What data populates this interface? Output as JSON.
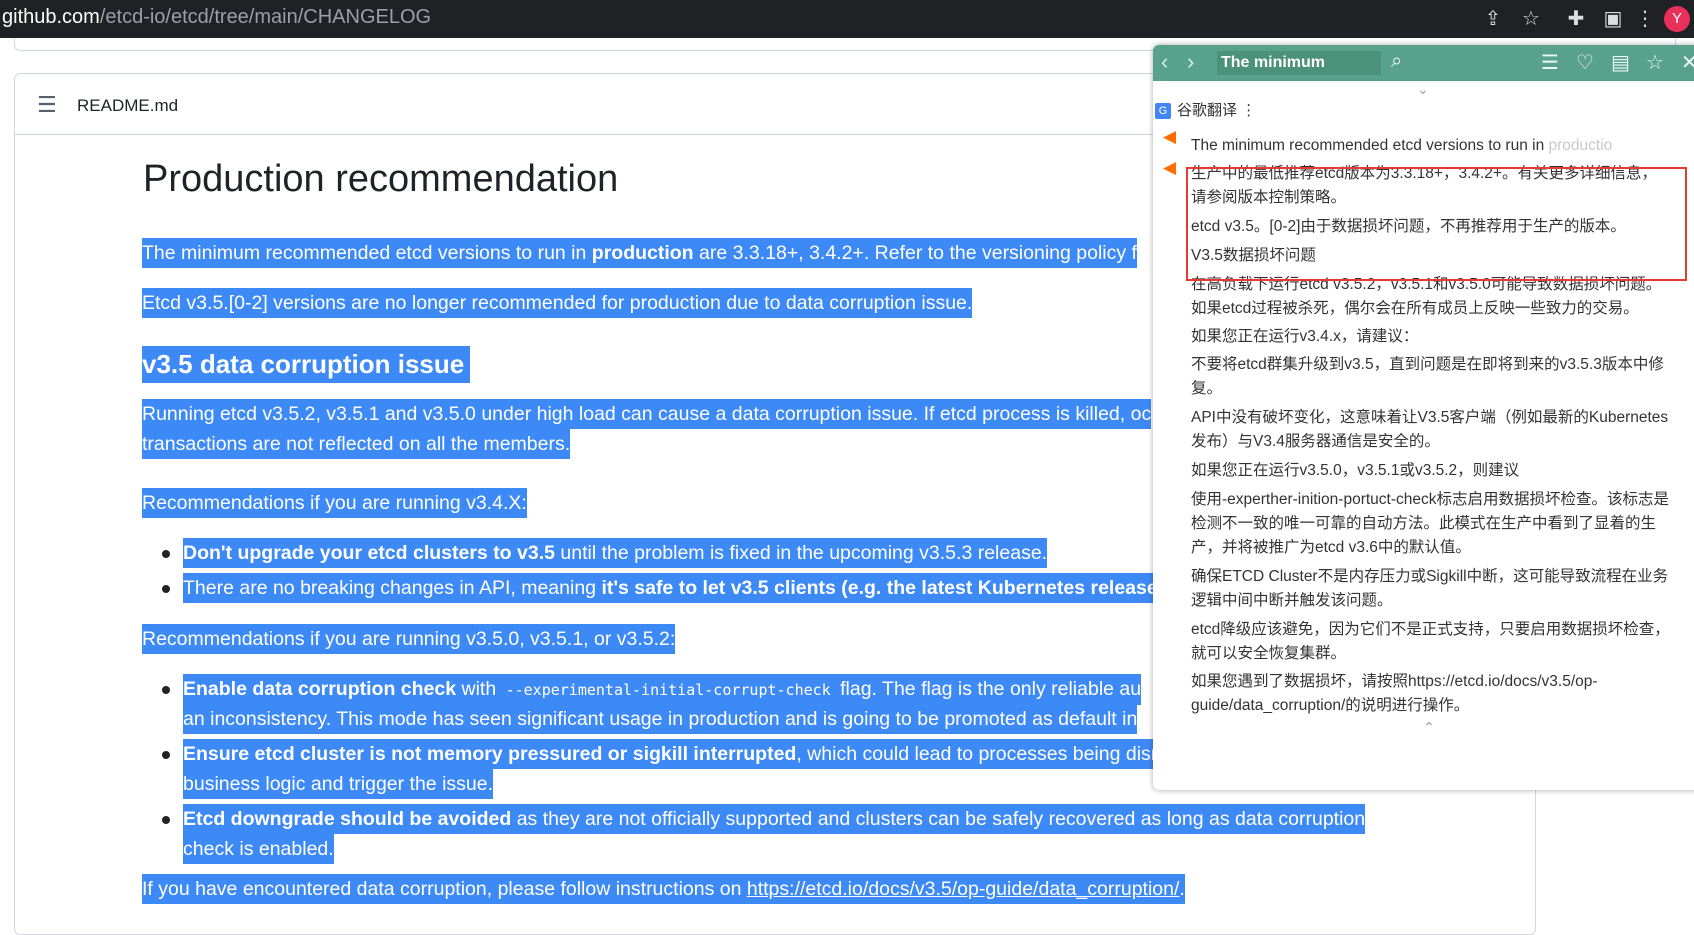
{
  "browser": {
    "url_host": "github.com",
    "url_path": "/etcd-io/etcd/tree/main/CHANGELOG",
    "avatar_letter": "Y"
  },
  "readme": {
    "file_name": "README.md",
    "heading": "Production recommendation",
    "p1_a": "The minimum recommended etcd versions to run in ",
    "p1_b": "production",
    "p1_c": " are 3.3.18+, 3.4.2+. Refer to the versioning policy f",
    "p2": "Etcd v3.5.[0-2] versions are no longer recommended for production due to data corruption issue.",
    "h2": "v3.5 data corruption issue",
    "p3_line1": "Running etcd v3.5.2, v3.5.1 and v3.5.0 under high load can cause a data corruption issue. If etcd process is killed, oc",
    "p3_line2": "transactions are not reflected on all the members.",
    "rec1": "Recommendations if you are running v3.4.X:",
    "b1_bold": "Don't upgrade your etcd clusters to v3.5",
    "b1_rest": " until the problem is fixed in the upcoming v3.5.3 release.",
    "b2_a": "There are no breaking changes in API, meaning ",
    "b2_bold": "it's safe to let v3.5 clients (e.g. the latest Kubernetes releases)",
    "rec2": "Recommendations if you are running v3.5.0, v3.5.1, or v3.5.2:",
    "b3_bold": "Enable data corruption check",
    "b3_with": " with ",
    "b3_code": "--experimental-initial-corrupt-check",
    "b3_rest": " flag. The flag is the only reliable au",
    "b3_line2": "an inconsistency. This mode has seen significant usage in production and is going to be promoted as default in",
    "b4_bold": "Ensure etcd cluster is not memory pressured or sigkill interrupted",
    "b4_rest": ", which could lead to processes being disru",
    "b4_line2": "business logic and trigger the issue.",
    "b5_bold": "Etcd downgrade should be avoided",
    "b5_rest": " as they are not officially supported and clusters can be safely recovered as long as data corruption",
    "b5_line2": "check is enabled.",
    "p_last_a": "If you have encountered data corruption, please follow instructions on ",
    "p_last_link": "https://etcd.io/docs/v3.5/op-guide/data_corruption/",
    "p_last_b": "."
  },
  "popup": {
    "query": "The minimum",
    "engine": "谷歌翻译",
    "engine_menu": "⋮",
    "source_a": "The minimum recommended etcd versions to run in ",
    "source_fade": "productio",
    "lines": [
      "生产中的最低推荐etcd版本为3.3.18+，3.4.2+。有关更多详细信息，",
      "请参阅版本控制策略。",
      "etcd v3.5。[0-2]由于数据损坏问题，不再推荐用于生产的版本。",
      "V3.5数据损坏问题",
      "在高负载下运行etcd v3.5.2，v3.5.1和v3.5.0可能导致数据损坏问题。",
      "如果etcd过程被杀死，偶尔会在所有成员上反映一些致力的交易。",
      "如果您正在运行v3.4.x，请建议：",
      "不要将etcd群集升级到v3.5，直到问题是在即将到来的v3.5.3版本中修",
      "复。",
      "API中没有破坏变化，这意味着让V3.5客户端（例如最新的Kubernetes",
      "发布）与V3.4服务器通信是安全的。",
      "如果您正在运行v3.5.0，v3.5.1或v3.5.2，则建议",
      "使用-experther-inition-portuct-check标志启用数据损坏检查。该标志是",
      "检测不一致的唯一可靠的自动方法。此模式在生产中看到了显着的生",
      "产，并将被推广为etcd v3.6中的默认值。",
      "确保ETCD Cluster不是内存压力或Sigkill中断，这可能导致流程在业务",
      "逻辑中间中断并触发该问题。",
      "etcd降级应该避免，因为它们不是正式支持，只要启用数据损坏检查，",
      "就可以安全恢复集群。",
      "如果您遇到了数据损坏，请按照https://etcd.io/docs/v3.5/op-",
      "guide/data_corruption/的说明进行操作。"
    ]
  },
  "icons": [
    "share-icon",
    "star-icon",
    "extensions-icon",
    "sidepanel-icon",
    "list-icon",
    "speaker-icon",
    "search-icon",
    "menu-icon",
    "heart-icon",
    "book-icon",
    "pin-icon",
    "close-icon"
  ],
  "colors": {
    "selection": "#3d8af7",
    "popup_bar": "#58a28b",
    "highlight_box": "#e53935"
  }
}
